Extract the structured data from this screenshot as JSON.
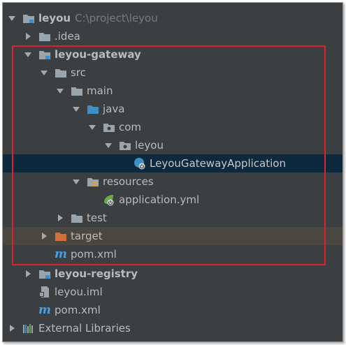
{
  "colors": {
    "panel_bg": "#3c3f41",
    "selected_bg": "#0d293e",
    "excluded_bg": "#4a4741",
    "text": "#bbbbbb",
    "path_text": "#7a7a7a",
    "highlight_border": "#e0202a",
    "folder_gray": "#9aa4ad",
    "folder_blue": "#3d8fc6",
    "folder_orange": "#d0703a",
    "maven_blue": "#4a9fe0"
  },
  "tree": {
    "root": {
      "label": "leyou",
      "path": "C:\\project\\leyou",
      "icon": "module-folder-icon"
    },
    "idea": {
      "label": ".idea",
      "icon": "folder-icon"
    },
    "gateway": {
      "label": "leyou-gateway",
      "icon": "module-folder-icon",
      "src": {
        "label": "src",
        "icon": "folder-icon"
      },
      "main": {
        "label": "main",
        "icon": "folder-icon"
      },
      "java": {
        "label": "java",
        "icon": "source-folder-icon"
      },
      "com": {
        "label": "com",
        "icon": "package-icon"
      },
      "leyou_pkg": {
        "label": "leyou",
        "icon": "package-icon"
      },
      "app_class": {
        "label": "LeyouGatewayApplication",
        "icon": "spring-boot-class-icon"
      },
      "resources": {
        "label": "resources",
        "icon": "resources-folder-icon"
      },
      "app_yml": {
        "label": "application.yml",
        "icon": "spring-config-icon"
      },
      "test": {
        "label": "test",
        "icon": "folder-icon"
      },
      "target": {
        "label": "target",
        "icon": "excluded-folder-icon"
      },
      "pom": {
        "label": "pom.xml",
        "icon": "maven-icon",
        "glyph": "m"
      }
    },
    "registry": {
      "label": "leyou-registry",
      "icon": "module-folder-icon"
    },
    "iml": {
      "label": "leyou.iml",
      "icon": "iml-file-icon"
    },
    "root_pom": {
      "label": "pom.xml",
      "icon": "maven-icon",
      "glyph": "m"
    },
    "ext_libs": {
      "label": "External Libraries",
      "icon": "libraries-icon"
    }
  }
}
